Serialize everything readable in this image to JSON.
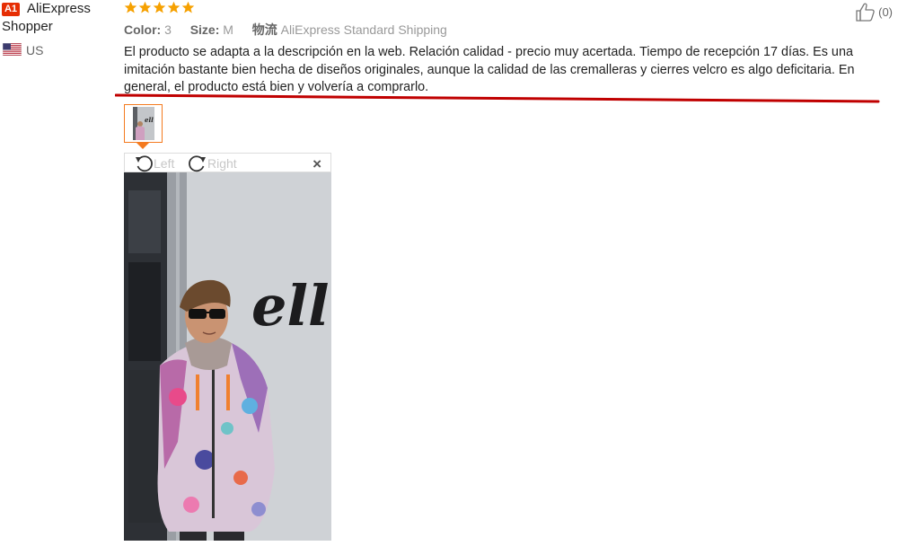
{
  "user": {
    "badge": "A1",
    "name_line1": "AliExpress",
    "name_line2": "Shopper",
    "country": "US"
  },
  "rating": {
    "stars": 5,
    "max": 5,
    "star_color": "#f6a101"
  },
  "attributes": {
    "color_label": "Color:",
    "color_value": "3",
    "size_label": "Size:",
    "size_value": "M",
    "shipping_label": "物流",
    "shipping_value": "AliExpress Standard Shipping"
  },
  "helpful": {
    "count_text": "(0)"
  },
  "review_text": "El producto se adapta a la descripción en la web. Relación calidad - precio muy acertada. Tiempo de recepción 17 días. Es una imitación bastante bien hecha de diseños originales, aunque la calidad de las cremalleras y cierres velcro es algo deficitaria. En general, el producto está bien y volvería a comprarlo.",
  "viewer": {
    "rotate_left_label": "Left",
    "rotate_right_label": "Right",
    "close_label": "×"
  },
  "photo": {
    "wall_text": "ell"
  },
  "colors": {
    "accent_orange": "#f47a1f",
    "annotation_red": "#c00000",
    "brand_red": "#e62e04"
  }
}
